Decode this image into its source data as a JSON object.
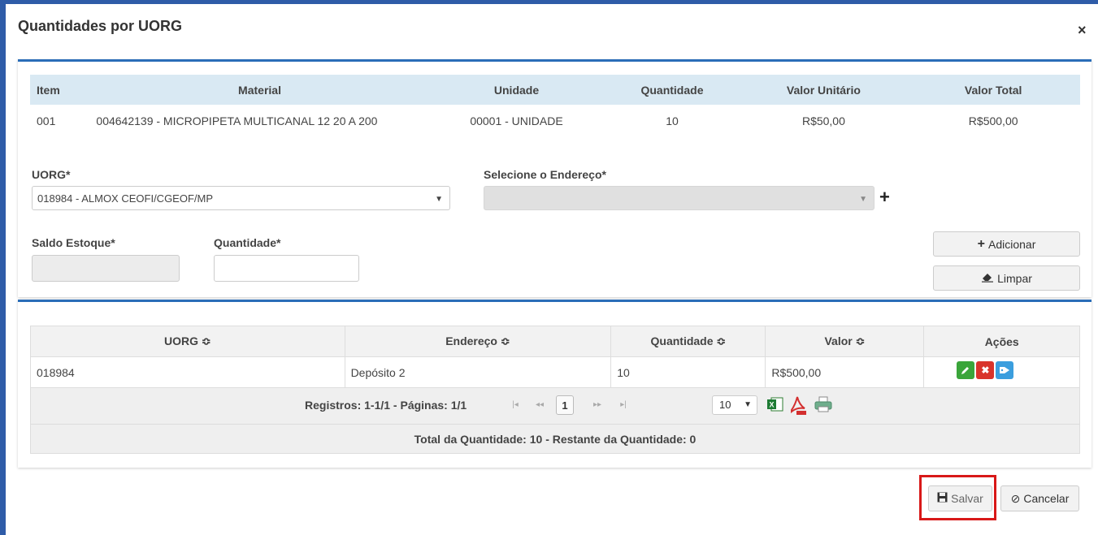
{
  "dialog": {
    "title": "Quantidades por UORG",
    "close_symbol": "×"
  },
  "item_table": {
    "headers": [
      "Item",
      "Material",
      "Unidade",
      "Quantidade",
      "Valor Unitário",
      "Valor Total"
    ],
    "row": [
      "001",
      "004642139 - MICROPIPETA MULTICANAL 12 20 A 200",
      "00001 - UNIDADE",
      "10",
      "R$50,00",
      "R$500,00"
    ]
  },
  "form": {
    "uorg_label": "UORG*",
    "uorg_value": "018984 - ALMOX CEOFI/CGEOF/MP",
    "endereco_label": "Selecione o Endereço*",
    "endereco_value": "",
    "saldo_label": "Saldo Estoque*",
    "saldo_value": "",
    "quantidade_label": "Quantidade*",
    "quantidade_value": "",
    "adicionar_label": "Adicionar",
    "limpar_label": "Limpar"
  },
  "grid": {
    "headers": [
      "UORG ≎",
      "Endereço ≎",
      "Quantidade ≎",
      "Valor ≎",
      "Ações"
    ],
    "rows": [
      {
        "uorg": "018984",
        "endereco": "Depósito 2",
        "quantidade": "10",
        "valor": "R$500,00"
      }
    ],
    "action_icons": [
      "edit-icon",
      "delete-icon",
      "tag-icon"
    ],
    "action_colors": [
      "#3aa53a",
      "#d9342b",
      "#3b9ede"
    ]
  },
  "pager": {
    "info": "Registros: 1-1/1 - Páginas: 1/1",
    "first": "|◂",
    "prev": "◂◂",
    "current_page": "1",
    "next": "▸▸",
    "last": "▸|",
    "per_page": "10",
    "export_icons": [
      "excel-icon",
      "pdf-icon",
      "print-icon"
    ]
  },
  "totals": {
    "text": "Total da Quantidade: 10   -   Restante da Quantidade: 0"
  },
  "footer": {
    "salvar_label": "Salvar",
    "cancelar_label": "Cancelar",
    "highlight_color": "#d81818"
  }
}
